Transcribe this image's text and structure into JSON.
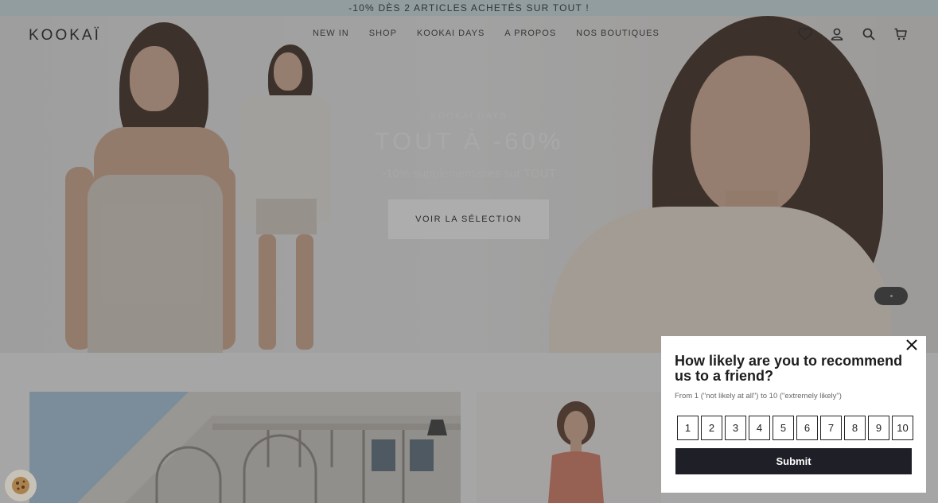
{
  "promo": {
    "text": "-10% DÈS 2 ARTICLES ACHETÉS SUR TOUT !"
  },
  "header": {
    "logo": "KOOKAÏ",
    "nav": [
      "NEW IN",
      "SHOP",
      "KOOKAI DAYS",
      "A PROPOS",
      "NOS BOUTIQUES"
    ],
    "icons": [
      "heart-icon",
      "account-icon",
      "search-icon",
      "cart-icon"
    ]
  },
  "hero": {
    "kicker": "KOOKAI DAYS",
    "title": "TOUT À -60%",
    "subtitle": "-10% supplementaires sur TOUT",
    "cta": "VOIR LA SÉLECTION"
  },
  "survey": {
    "question": "How likely are you to recommend us to a friend?",
    "hint": "From 1 (\"not likely at all\") to 10 (\"extremely likely\")",
    "scale": [
      "1",
      "2",
      "3",
      "4",
      "5",
      "6",
      "7",
      "8",
      "9",
      "10"
    ],
    "submit": "Submit"
  },
  "colors": {
    "promo_bg": "#cfe3e6",
    "submit_bg": "#1f1f27",
    "overlay": "rgba(60,60,60,0.42)"
  }
}
